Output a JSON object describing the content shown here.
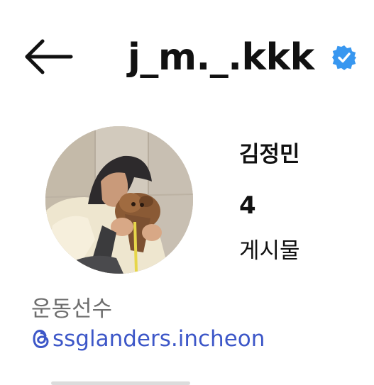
{
  "header": {
    "back_icon": "arrow-left-icon",
    "username": "j_m._.kkk",
    "verified_icon": "verified-badge-icon",
    "verified_color": "#3897f0"
  },
  "profile": {
    "display_name": "김정민",
    "posts_count": "4",
    "posts_label": "게시물"
  },
  "bio": {
    "category": "운동선수",
    "threads_icon": "threads-icon",
    "threads_handle": "ssglanders.incheon",
    "link_color": "#3d57c8"
  }
}
